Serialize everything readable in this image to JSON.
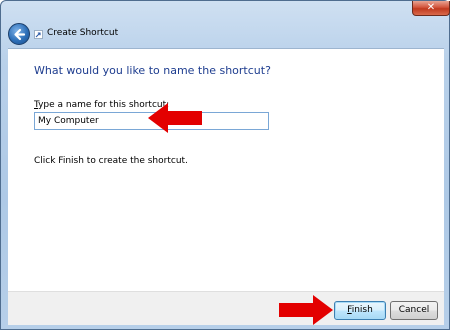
{
  "window": {
    "close_glyph": "✕"
  },
  "header": {
    "title": "Create Shortcut",
    "back_icon": "back-arrow-icon",
    "app_icon": "shortcut-icon"
  },
  "content": {
    "heading": "What would you like to name the shortcut?",
    "name_label_accesskey": "T",
    "name_label_rest": "ype a name for this shortcut:",
    "name_value": "My Computer",
    "hint": "Click Finish to create the shortcut."
  },
  "footer": {
    "finish_accesskey": "F",
    "finish_rest": "inish",
    "cancel_label": "Cancel"
  },
  "colors": {
    "heading": "#1e3d8f",
    "annotation_arrow": "#e30000",
    "frame": "#b9d1ea"
  }
}
